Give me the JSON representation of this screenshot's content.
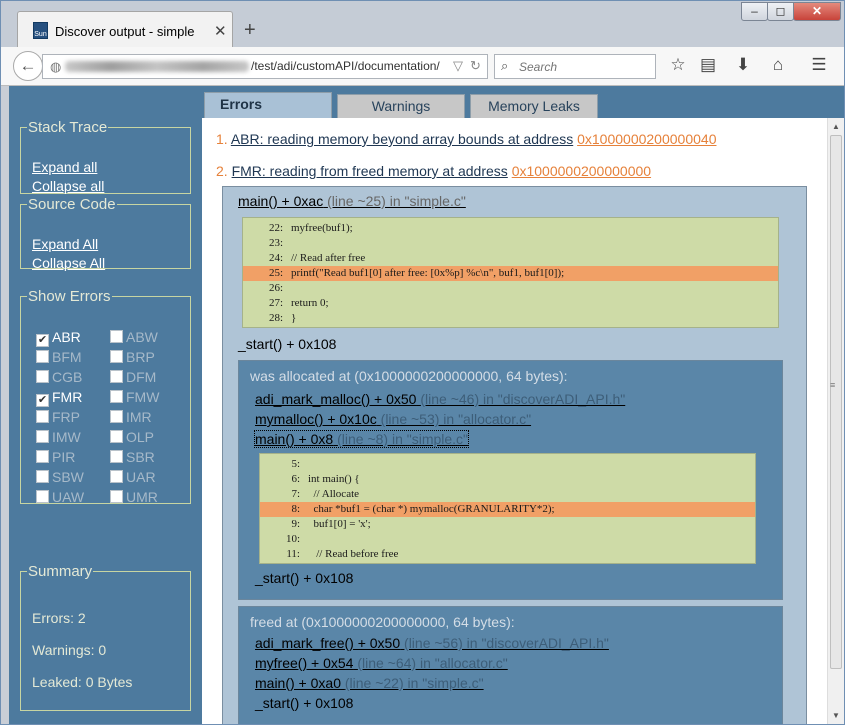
{
  "browser": {
    "tab_title": "Discover output - simple",
    "tab_icon": "Sun",
    "url": "/test/adi/customAPI/documentation/",
    "search_placeholder": "Search"
  },
  "sidebar": {
    "stack_trace": {
      "title": "Stack Trace",
      "expand": "Expand all",
      "collapse": "Collapse all"
    },
    "source_code": {
      "title": "Source Code",
      "expand": "Expand All",
      "collapse": "Collapse All"
    },
    "show_errors": {
      "title": "Show Errors",
      "items": [
        {
          "label": "ABR",
          "checked": true
        },
        {
          "label": "ABW",
          "checked": false
        },
        {
          "label": "BFM",
          "checked": false
        },
        {
          "label": "BRP",
          "checked": false
        },
        {
          "label": "CGB",
          "checked": false
        },
        {
          "label": "DFM",
          "checked": false
        },
        {
          "label": "FMR",
          "checked": true
        },
        {
          "label": "FMW",
          "checked": false
        },
        {
          "label": "FRP",
          "checked": false
        },
        {
          "label": "IMR",
          "checked": false
        },
        {
          "label": "IMW",
          "checked": false
        },
        {
          "label": "OLP",
          "checked": false
        },
        {
          "label": "PIR",
          "checked": false
        },
        {
          "label": "SBR",
          "checked": false
        },
        {
          "label": "SBW",
          "checked": false
        },
        {
          "label": "UAR",
          "checked": false
        },
        {
          "label": "UAW",
          "checked": false
        },
        {
          "label": "UMR",
          "checked": false
        }
      ]
    },
    "summary": {
      "title": "Summary",
      "errors": "Errors: 2",
      "warnings": "Warnings: 0",
      "leaked": "Leaked: 0 Bytes"
    }
  },
  "tabs": [
    "Errors",
    "Warnings",
    "Memory Leaks"
  ],
  "errors": [
    {
      "num": "1.",
      "message": "ABR: reading memory beyond array bounds at address",
      "address": "0x1000000200000040"
    },
    {
      "num": "2.",
      "message": "FMR: reading from freed memory at address",
      "address": "0x1000000200000000"
    }
  ],
  "stack": {
    "frame1": {
      "func": "main() + 0xac",
      "loc": "(line ~25) in \"simple.c\""
    },
    "code1": [
      {
        "n": "22:",
        "t": "myfree(buf1);",
        "hl": false
      },
      {
        "n": "23:",
        "t": "",
        "hl": false
      },
      {
        "n": "24:",
        "t": "// Read after free",
        "hl": false
      },
      {
        "n": "25:",
        "t": "printf(\"Read buf1[0] after free: [0x%p] %c\\n\", buf1, buf1[0]);",
        "hl": true
      },
      {
        "n": "26:",
        "t": "",
        "hl": false
      },
      {
        "n": "27:",
        "t": "return 0;",
        "hl": false
      },
      {
        "n": "28:",
        "t": "}",
        "hl": false
      }
    ],
    "frame2": {
      "func": "_start() + 0x108"
    },
    "allocated": {
      "title": "was allocated at (0x1000000200000000, 64 bytes):",
      "frames": [
        {
          "func": "adi_mark_malloc() + 0x50",
          "loc": "(line ~46) in \"discoverADI_API.h\""
        },
        {
          "func": "mymalloc() + 0x10c",
          "loc": "(line ~53) in \"allocator.c\""
        },
        {
          "func": "main() + 0x8",
          "loc": "(line ~8) in \"simple.c\""
        }
      ],
      "code": [
        {
          "n": "5:",
          "t": "",
          "hl": false
        },
        {
          "n": "6:",
          "t": "int main() {",
          "hl": false
        },
        {
          "n": "7:",
          "t": "  // Allocate",
          "hl": false
        },
        {
          "n": "8:",
          "t": "  char *buf1 = (char *) mymalloc(GRANULARITY*2);",
          "hl": true
        },
        {
          "n": "9:",
          "t": "  buf1[0] = 'x';",
          "hl": false
        },
        {
          "n": "10:",
          "t": "",
          "hl": false
        },
        {
          "n": "11:",
          "t": "   // Read before free",
          "hl": false
        }
      ],
      "start": "_start() + 0x108"
    },
    "freed": {
      "title": "freed at (0x1000000200000000, 64 bytes):",
      "frames": [
        {
          "func": "adi_mark_free() + 0x50",
          "loc": "(line ~56) in \"discoverADI_API.h\""
        },
        {
          "func": "myfree() + 0x54",
          "loc": "(line ~64) in \"allocator.c\""
        },
        {
          "func": "main() + 0xa0",
          "loc": "(line ~22) in \"simple.c\""
        }
      ],
      "start": "_start() + 0x108"
    }
  }
}
